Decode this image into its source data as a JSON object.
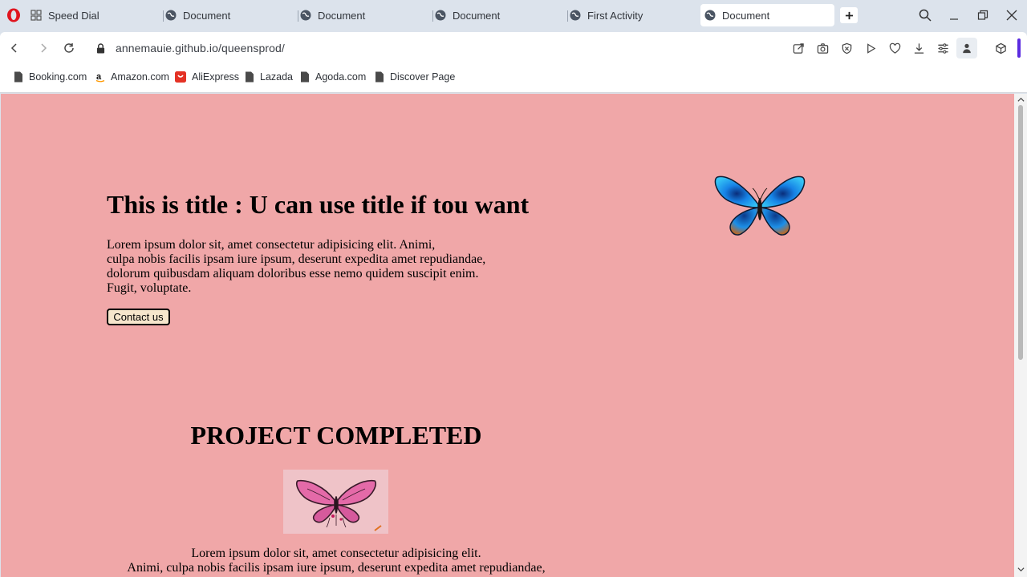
{
  "browser": {
    "tabs": [
      {
        "label": "Speed Dial",
        "icon": "speed-dial-icon",
        "active": false
      },
      {
        "label": "Document",
        "icon": "globe-icon",
        "active": false
      },
      {
        "label": "Document",
        "icon": "globe-icon",
        "active": false
      },
      {
        "label": "Document",
        "icon": "globe-icon",
        "active": false
      },
      {
        "label": "First Activity",
        "icon": "globe-icon",
        "active": false
      },
      {
        "label": "Document",
        "icon": "globe-icon",
        "active": true
      }
    ],
    "url": "annemauie.github.io/queensprod/",
    "bookmarks": [
      {
        "label": "Booking.com",
        "icon": "page-icon"
      },
      {
        "label": "Amazon.com",
        "icon": "amazon-icon"
      },
      {
        "label": "AliExpress",
        "icon": "aliexpress-icon"
      },
      {
        "label": "Lazada",
        "icon": "page-icon"
      },
      {
        "label": "Agoda.com",
        "icon": "page-icon"
      },
      {
        "label": "Discover Page",
        "icon": "page-icon"
      }
    ],
    "accent_color": "#5b2be0"
  },
  "page": {
    "background": "#f0a7a8",
    "hero": {
      "title": "This is title : U can use title if tou want",
      "text_lines": [
        "Lorem ipsum dolor sit, amet consectetur adipisicing elit. Animi,",
        "culpa nobis facilis ipsam iure ipsum, deserunt expedita amet repudiandae,",
        "dolorum quibusdam aliquam doloribus esse nemo quidem suscipit enim.",
        "Fugit, voluptate."
      ],
      "button": "Contact us",
      "image": "blue-butterfly"
    },
    "projects": {
      "title": "PROJECT COMPLETED",
      "image": "pink-butterfly",
      "text_lines": [
        "Lorem ipsum dolor sit, amet consectetur adipisicing elit.",
        "Animi, culpa nobis facilis ipsam iure ipsum, deserunt expedita amet repudiandae,"
      ]
    }
  }
}
